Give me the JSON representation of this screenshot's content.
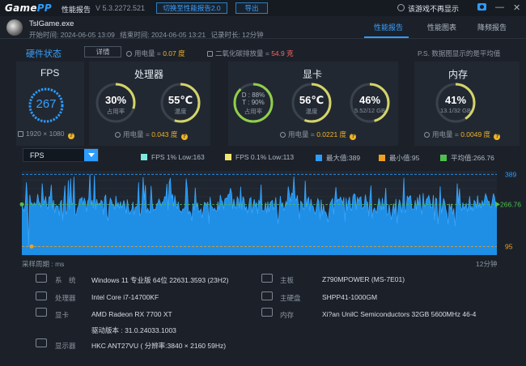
{
  "app": {
    "logo_a": "Game",
    "logo_b": "PP",
    "title": "性能报告",
    "version": "V 5.3.2272.521",
    "switch_button": "切换至性能报告2.0",
    "export_button": "导出",
    "no_show_label": "该游戏不再显示",
    "win_min": "—",
    "win_close": "✕"
  },
  "game": {
    "name": "TslGame.exe",
    "start_label": "开始时间: 2024-06-05 13:09",
    "end_label": "结束时间: 2024-06-05 13:21",
    "duration_label": "记录时长: 12分钟"
  },
  "tabs": [
    "性能报告",
    "性能图表",
    "降频报告"
  ],
  "hardware": {
    "title": "硬件状态",
    "detail_button": "详情",
    "power_label": "用电量 = ",
    "power_value": "0.07 度",
    "co2_label": "二氧化碳排放量 = ",
    "co2_value": "54.9 克",
    "ps_note": "P.S. 数据图显示的是平均值"
  },
  "fps_panel": {
    "label": "FPS",
    "value": "267",
    "resolution": "1920 × 1080"
  },
  "cpu_panel": {
    "label": "处理器",
    "usage_value": "30%",
    "usage_sub": "占用率",
    "usage_fraction": 0.3,
    "temp_value": "55℃",
    "temp_sub": "温度",
    "temp_fraction": 0.55,
    "power_label": "用电量 = ",
    "power_value": "0.043 度"
  },
  "gpu_panel": {
    "label": "显卡",
    "d_line": "D : 88%",
    "t_line": "T : 90%",
    "usage_sub": "占用率",
    "usage_fraction": 0.88,
    "temp_value": "56℃",
    "temp_sub": "温度",
    "temp_fraction": 0.56,
    "vram_value": "46%",
    "vram_sub": "5.52/12 GB",
    "vram_fraction": 0.46,
    "power_label": "用电量 = ",
    "power_value": "0.0221 度"
  },
  "mem_panel": {
    "label": "内存",
    "value": "41%",
    "sub": "13.1/32 GB",
    "fraction": 0.41,
    "power_label": "用电量 = ",
    "power_value": "0.0049 度"
  },
  "colors": {
    "accent": "#2d9cff",
    "gauge_ring": "#d4d36a",
    "gauge_ring_green": "#8fcf4a",
    "fps_low1": "#7ee8e0",
    "fps_low01": "#f2e86d",
    "max": "#2d9cff",
    "min": "#f0a020",
    "avg": "#4fc04f"
  },
  "chart": {
    "dropdown_value": "FPS",
    "legend": [
      {
        "label": "FPS 1% Low:163",
        "color": "#7ee8e0"
      },
      {
        "label": "FPS 0.1% Low:113",
        "color": "#f2e86d"
      },
      {
        "label": "最大值:389",
        "color": "#2d9cff"
      },
      {
        "label": "最小值:95",
        "color": "#f0a020"
      },
      {
        "label": "平均值:266.76",
        "color": "#4fc04f"
      }
    ],
    "x_caption_left": "采样周期 : ms",
    "x_caption_right": "12分钟"
  },
  "chart_data": {
    "type": "area",
    "series": [
      {
        "name": "FPS"
      }
    ],
    "max": 389,
    "min": 95,
    "avg": 266.76,
    "max_label": "389",
    "min_label": "95",
    "avg_label": "266.76",
    "x_end_label": "12分钟"
  },
  "system": {
    "os_label": "系　统",
    "os_value": "Windows 11 专业版 64位 22631.3593 (23H2)",
    "cpu_label": "处理器",
    "cpu_value": "Intel Core i7-14700KF",
    "gpu_label": "显卡",
    "gpu_value": "AMD Radeon RX 7700 XT",
    "driver_value": "驱动版本 : 31.0.24033.1003",
    "monitor_label": "显示器",
    "monitor_value": "HKC ANT27VU ( 分辨率:3840 × 2160 59Hz)",
    "board_label": "主板",
    "board_value": "Z790MPOWER (MS-7E01)",
    "disk_label": "主硬盘",
    "disk_value": "SHPP41-1000GM",
    "ram_label": "内存",
    "ram_value": "Xi?an UnilC Semiconductors 32GB 5600MHz 46-4"
  }
}
